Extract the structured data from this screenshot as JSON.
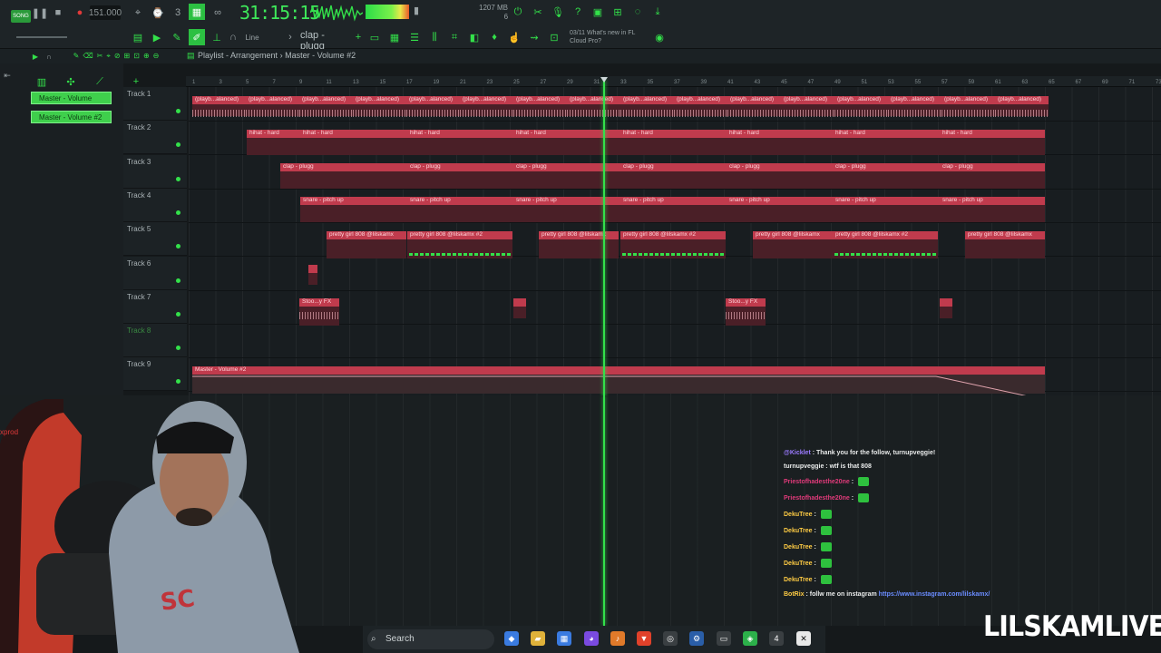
{
  "toolbar": {
    "song_badge": "SONG",
    "bpm": "151.000",
    "time": "31:15:15",
    "memory_top": "1207 MB",
    "memory_bottom": "6",
    "pattern": "clap - plugg",
    "snap": "Line",
    "news_date": "03/11",
    "news_text1": "What's new in FL",
    "news_text2": "Cloud Pro?"
  },
  "playlist": {
    "title": "Playlist - Arrangement",
    "separator": "›",
    "pattern": "Master - Volume #2",
    "picker": [
      "Master - Volume",
      "Master - Volume #2"
    ],
    "ruler": [
      "1",
      "3",
      "5",
      "7",
      "9",
      "11",
      "13",
      "15",
      "17",
      "19",
      "21",
      "23",
      "25",
      "27",
      "29",
      "31",
      "33",
      "35",
      "37",
      "39",
      "41",
      "43",
      "45",
      "47",
      "49",
      "51",
      "53",
      "55",
      "57",
      "59",
      "61",
      "63",
      "65",
      "67",
      "69",
      "71",
      "73"
    ],
    "tracks": [
      "Track 1",
      "Track 2",
      "Track 3",
      "Track 4",
      "Track 5",
      "Track 6",
      "Track 7",
      "Track 8",
      "Track 9"
    ],
    "clips": {
      "t1": "(playb...alanced)",
      "t2": "hihat - hard",
      "t3": "clap - plugg",
      "t4": "snare - pitch up",
      "t5a": "pretty girl 808 @lilskamx",
      "t5b": "pretty girl 808 @lilskamx #2",
      "t7": "Stoo...y FX",
      "t9": "Master - Volume #2"
    }
  },
  "chat": [
    {
      "user": "@Kicklet",
      "text": ": Thank you for the follow, turnupveggie!"
    },
    {
      "user": "turnupveggie",
      "text": ": wtf is that 808"
    },
    {
      "user": "Priestofhadesthe20ne",
      "text": ":"
    },
    {
      "user": "Priestofhadesthe20ne",
      "text": ":"
    },
    {
      "user": "DekuTree",
      "text": ":"
    },
    {
      "user": "DekuTree",
      "text": ":"
    },
    {
      "user": "DekuTree",
      "text": ":"
    },
    {
      "user": "DekuTree",
      "text": ":"
    },
    {
      "user": "DekuTree",
      "text": ":"
    },
    {
      "user": "BotRix",
      "text": ": follw me on instagram",
      "link": "https://www.instagram.com/lilskamx/"
    }
  ],
  "side_text": "xprod",
  "taskbar": {
    "search": "Search"
  },
  "brand": "LILSKAMLIVE",
  "colors": {
    "accent": "#33e04a",
    "clip": "#c03b4d",
    "clip_body": "#4a1f27"
  }
}
